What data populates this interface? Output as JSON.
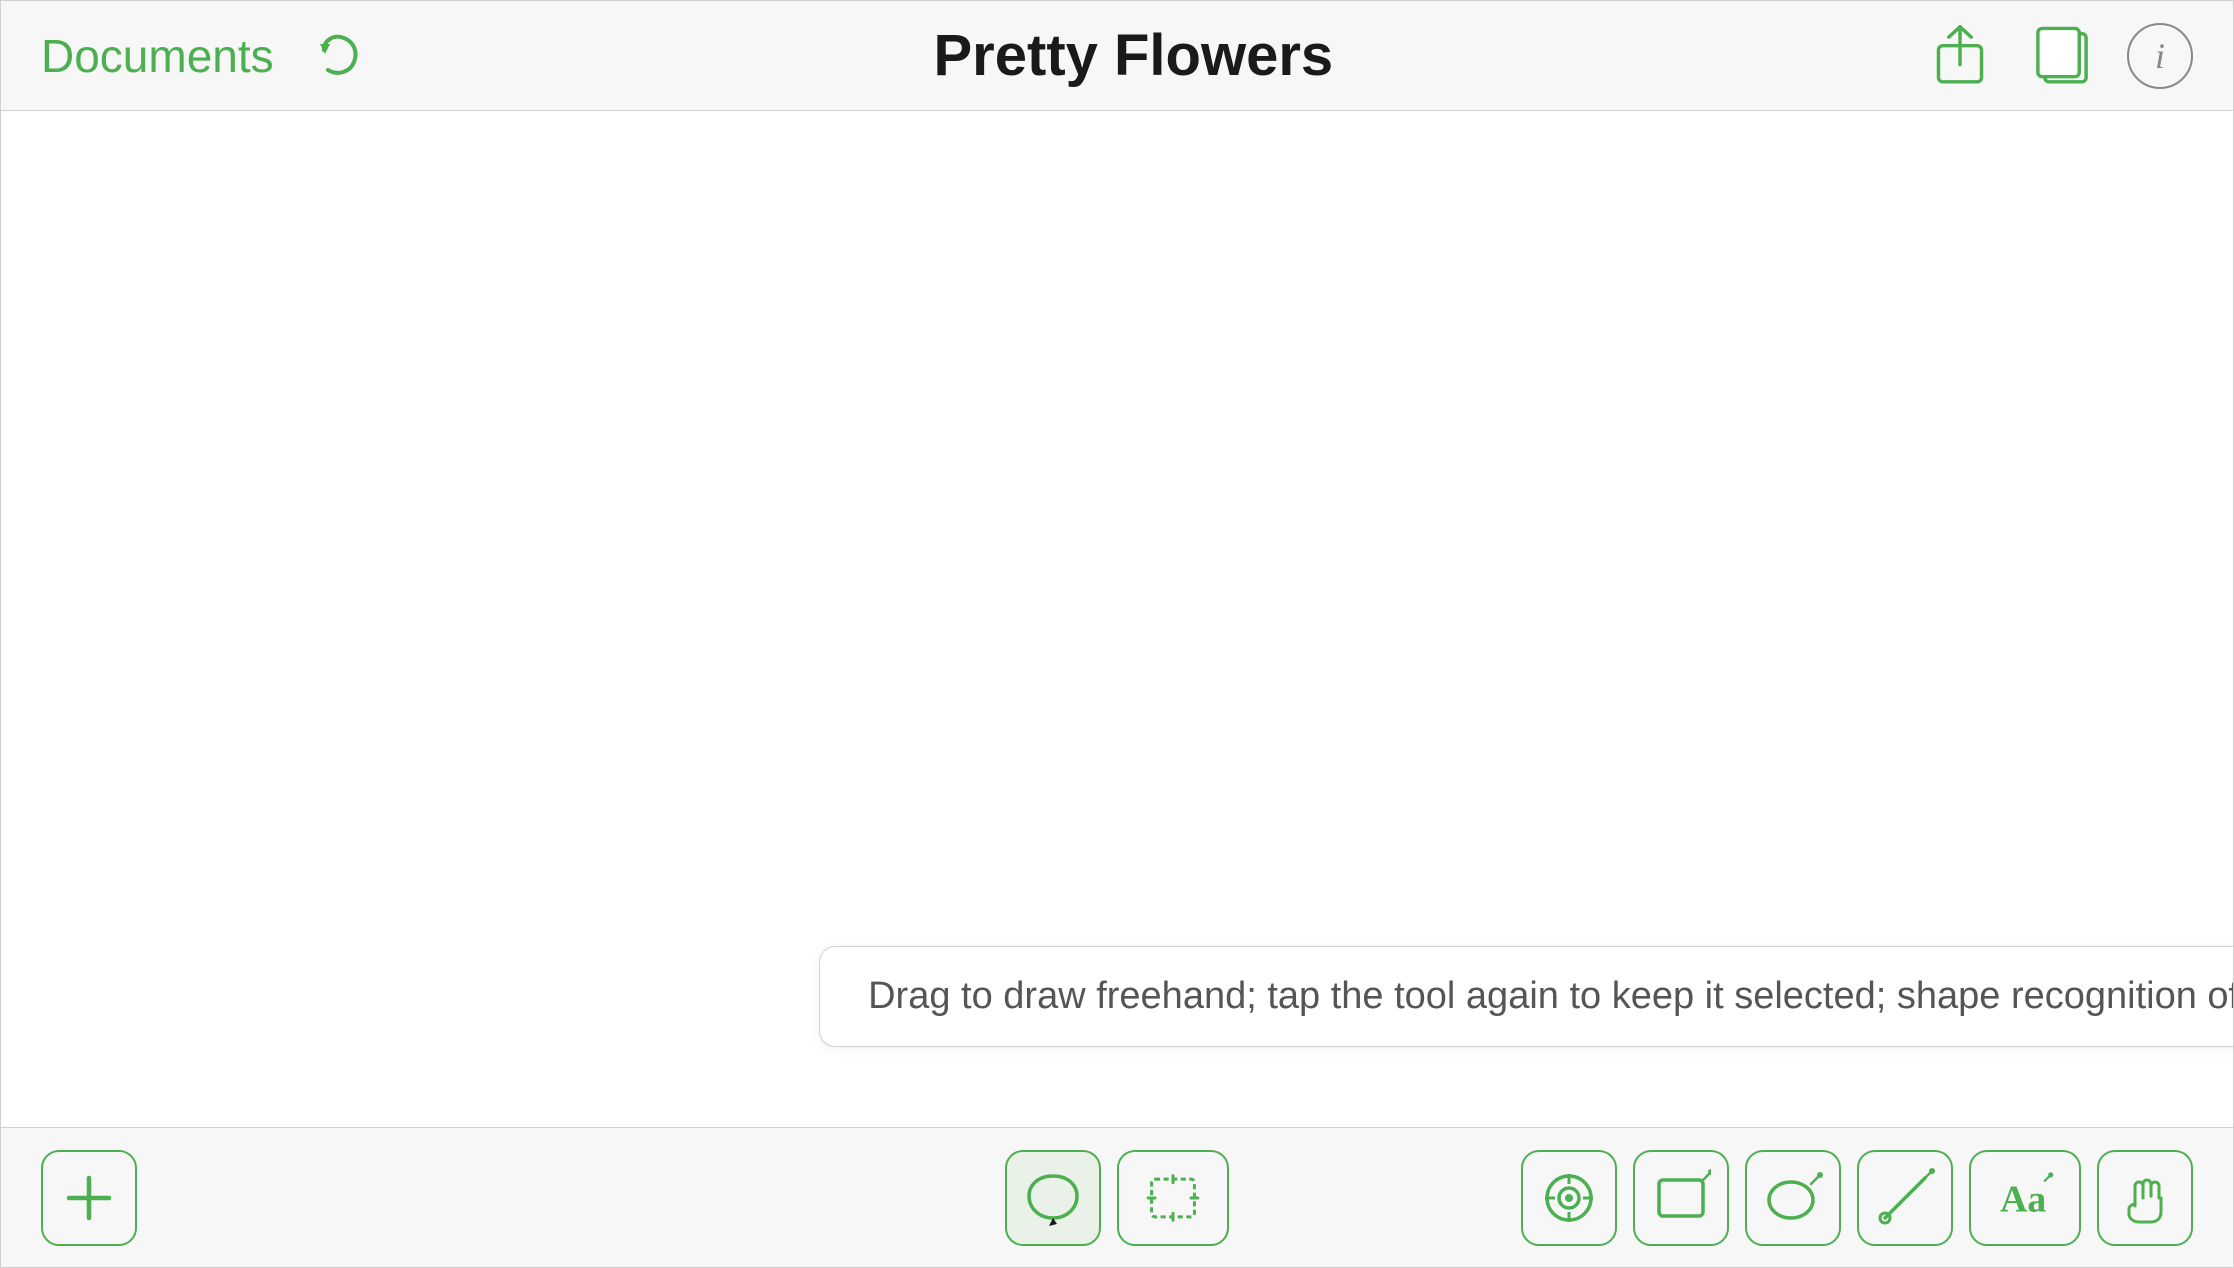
{
  "header": {
    "documents_label": "Documents",
    "title": "Pretty Flowers",
    "info_label": "i"
  },
  "canvas": {
    "hint_text": "Drag to draw freehand; tap the tool again to keep it selected; shape recognition off."
  },
  "toolbar": {
    "add_label": "+",
    "tools": [
      {
        "name": "lasso",
        "label": "Lasso"
      },
      {
        "name": "select",
        "label": "Select"
      },
      {
        "name": "target",
        "label": "Target"
      },
      {
        "name": "rectangle",
        "label": "Rectangle"
      },
      {
        "name": "ellipse",
        "label": "Ellipse"
      },
      {
        "name": "line",
        "label": "Line"
      },
      {
        "name": "text",
        "label": "Text"
      },
      {
        "name": "hand",
        "label": "Hand"
      }
    ]
  }
}
